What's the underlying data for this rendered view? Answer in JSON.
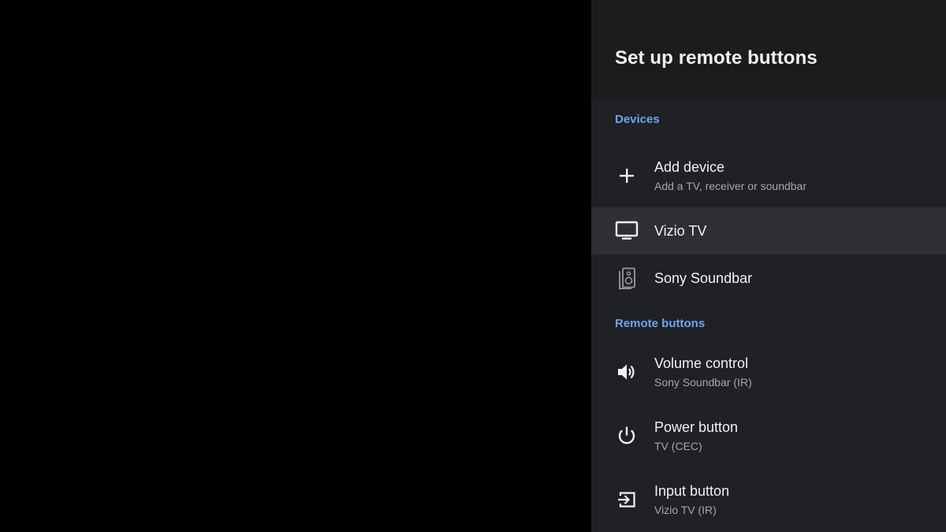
{
  "panel": {
    "title": "Set up remote buttons"
  },
  "sections": {
    "devices": {
      "header": "Devices",
      "items": [
        {
          "title": "Add device",
          "subtitle": "Add a TV, receiver or soundbar",
          "icon": "plus-icon"
        },
        {
          "title": "Vizio TV",
          "icon": "tv-icon",
          "focused": true
        },
        {
          "title": "Sony Soundbar",
          "icon": "speaker-icon"
        }
      ]
    },
    "remote_buttons": {
      "header": "Remote buttons",
      "items": [
        {
          "title": "Volume control",
          "subtitle": "Sony Soundbar (IR)",
          "icon": "volume-icon"
        },
        {
          "title": "Power button",
          "subtitle": "TV (CEC)",
          "icon": "power-icon"
        },
        {
          "title": "Input button",
          "subtitle": "Vizio TV (IR)",
          "icon": "input-icon"
        }
      ]
    }
  },
  "colors": {
    "backdrop": "#000000",
    "panel_background": "#202124",
    "header_background": "#1c1c1d",
    "focused_row": "#2e2f33",
    "section_header": "#6ba4f0",
    "primary_text": "#f1f1f1",
    "secondary_text": "#a7a7ab"
  }
}
